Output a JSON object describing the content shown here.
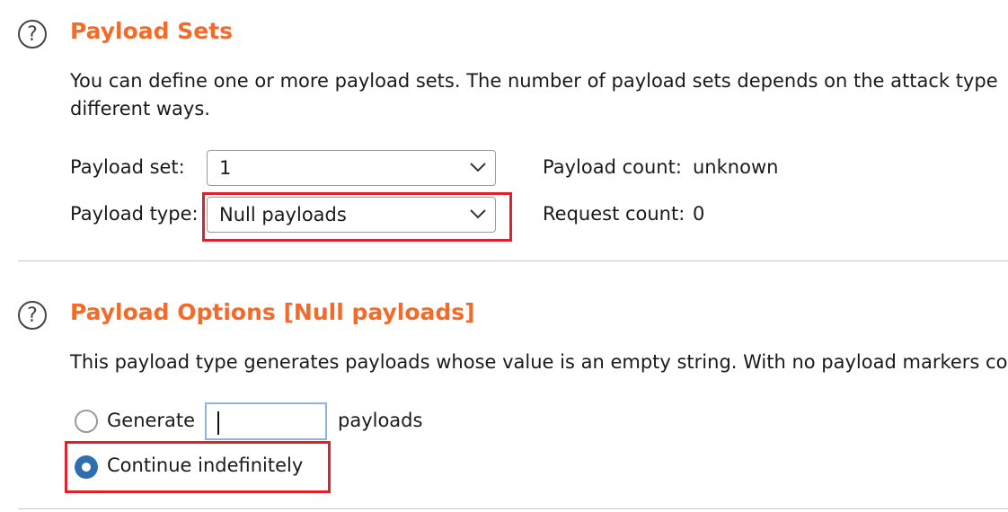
{
  "payload_sets": {
    "help_icon": "help-icon",
    "title": "Payload Sets",
    "description_line1": "You can define one or more payload sets. The number of payload sets depends on the attack type",
    "description_line2": "different ways.",
    "payload_set_label": "Payload set:",
    "payload_set_value": "1",
    "payload_type_label": "Payload type:",
    "payload_type_value": "Null payloads",
    "payload_count_label": "Payload count:",
    "payload_count_value": "unknown",
    "request_count_label": "Request count:",
    "request_count_value": "0"
  },
  "payload_options": {
    "help_icon": "help-icon",
    "title": "Payload Options [Null payloads]",
    "description": "This payload type generates payloads whose value is an empty string. With no payload markers co",
    "generate_label": "Generate",
    "generate_value": "",
    "payloads_suffix": "payloads",
    "continue_label": "Continue indefinitely",
    "selected_option": "Continue indefinitely"
  },
  "colors": {
    "accent": "#f26b2a",
    "highlight": "#e0202a",
    "radio_selected": "#2f6fb0"
  }
}
